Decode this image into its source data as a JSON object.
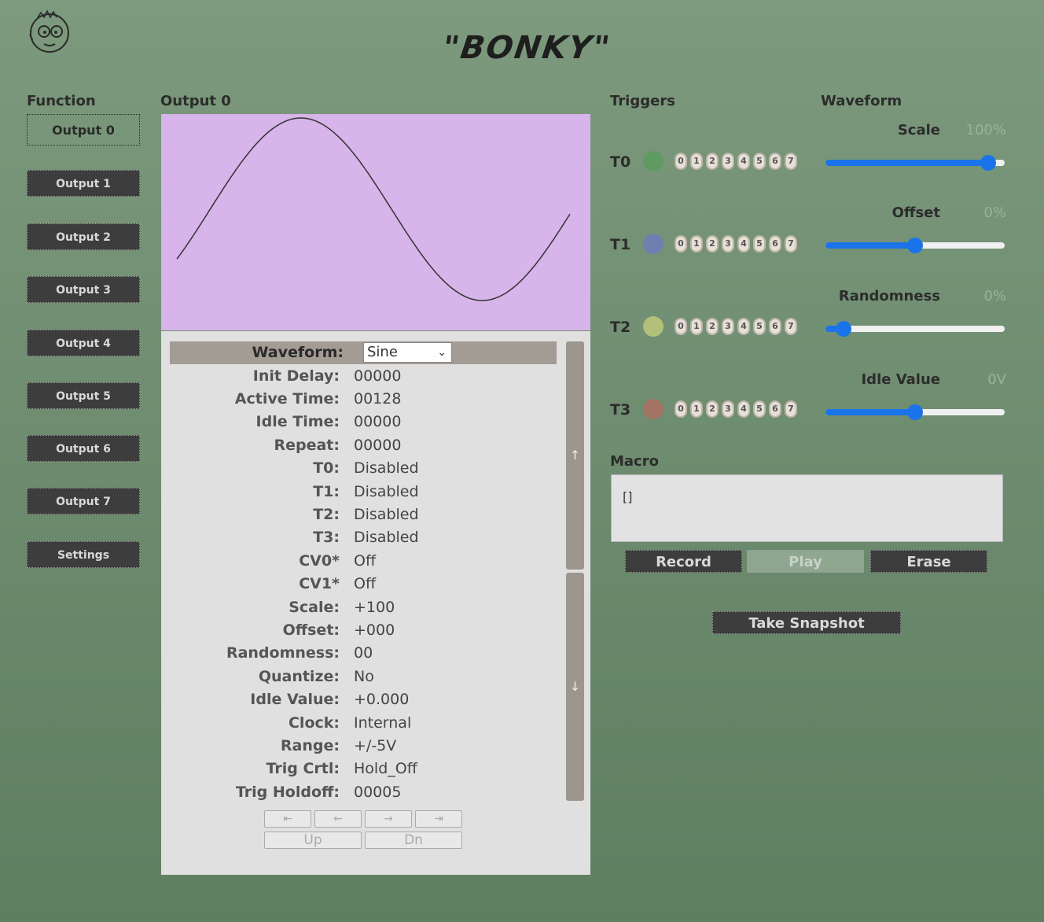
{
  "header": {
    "title": "\"BONKY\"",
    "logo_icon": "face-sketch-icon"
  },
  "function_section": {
    "label": "Function",
    "items": [
      "Output 0",
      "Output 1",
      "Output 2",
      "Output 3",
      "Output 4",
      "Output 5",
      "Output 6",
      "Output 7",
      "Settings"
    ],
    "active_index": 0
  },
  "output_section": {
    "label": "Output 0",
    "plot_background": "#d7b4e9",
    "waveform_label": "Waveform:",
    "waveform_value": "Sine",
    "params": [
      {
        "k": "Init Delay:",
        "v": "00000"
      },
      {
        "k": "Active Time:",
        "v": "00128"
      },
      {
        "k": "Idle Time:",
        "v": "00000"
      },
      {
        "k": "Repeat:",
        "v": "00000"
      },
      {
        "k": "T0:",
        "v": "Disabled"
      },
      {
        "k": "T1:",
        "v": "Disabled"
      },
      {
        "k": "T2:",
        "v": "Disabled"
      },
      {
        "k": "T3:",
        "v": "Disabled"
      },
      {
        "k": "CV0*",
        "v": "Off"
      },
      {
        "k": "CV1*",
        "v": "Off"
      },
      {
        "k": "Scale:",
        "v": "+100"
      },
      {
        "k": "Offset:",
        "v": "+000"
      },
      {
        "k": "Randomness:",
        "v": "00"
      },
      {
        "k": "Quantize:",
        "v": "No"
      },
      {
        "k": "Idle Value:",
        "v": "+0.000"
      },
      {
        "k": "Clock:",
        "v": "Internal"
      },
      {
        "k": "Range:",
        "v": "+/-5V"
      },
      {
        "k": "Trig Crtl:",
        "v": "Hold_Off"
      },
      {
        "k": "Trig Holdoff:",
        "v": "00005"
      }
    ],
    "scroll_up": "↑",
    "scroll_down": "↓",
    "nav": {
      "first": "⇤",
      "left": "←",
      "right": "→",
      "last": "⇥",
      "up": "Up",
      "dn": "Dn"
    }
  },
  "triggers_section": {
    "label": "Triggers",
    "bits": [
      "0",
      "1",
      "2",
      "3",
      "4",
      "5",
      "6",
      "7"
    ],
    "triggers": [
      {
        "name": "T0",
        "color": "#5f9a63"
      },
      {
        "name": "T1",
        "color": "#6e80b0"
      },
      {
        "name": "T2",
        "color": "#b3c07a"
      },
      {
        "name": "T3",
        "color": "#a47462"
      }
    ]
  },
  "waveform_section": {
    "label": "Waveform",
    "sliders": [
      {
        "label": "Scale",
        "value": "100%",
        "level": 0.91
      },
      {
        "label": "Offset",
        "value": "0%",
        "level": 0.5
      },
      {
        "label": "Randomness",
        "value": "0%",
        "level": 0.1
      },
      {
        "label": "Idle Value",
        "value": "0V",
        "level": 0.5
      }
    ]
  },
  "macro_section": {
    "label": "Macro",
    "text": "[]",
    "record": "Record",
    "play": "Play",
    "erase": "Erase",
    "snapshot": "Take Snapshot"
  }
}
